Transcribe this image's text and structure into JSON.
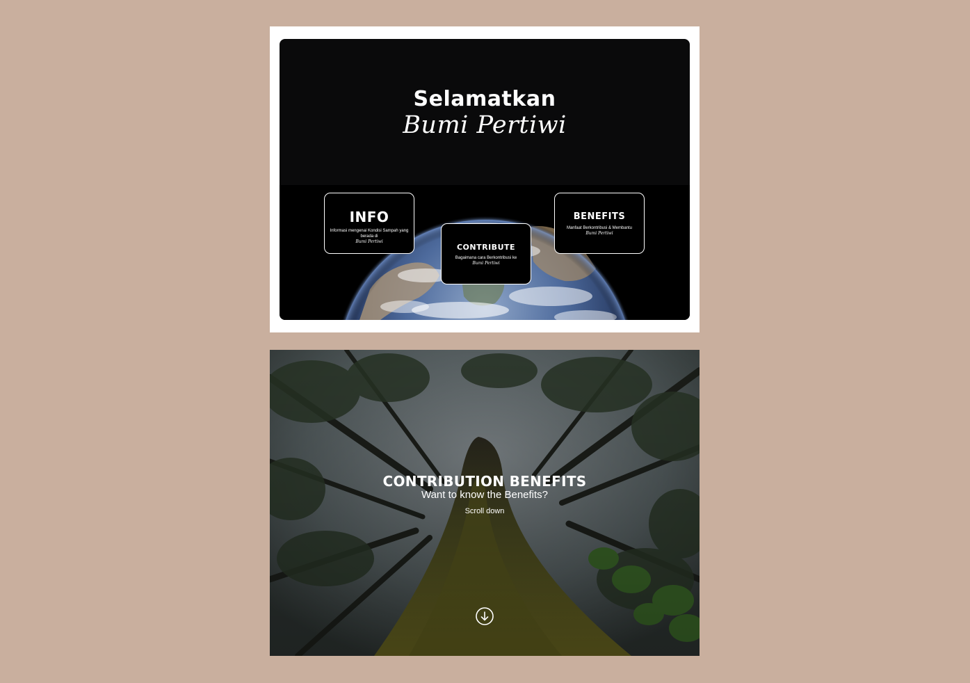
{
  "hero": {
    "title_line1": "Selamatkan",
    "title_line2": "Bumi Pertiwi"
  },
  "cards": {
    "info": {
      "title": "INFO",
      "desc": "Informasi mengenai Kondisi Sampah yang berada di",
      "desc_italic": "Bumi Pertiwi"
    },
    "contribute": {
      "title": "CONTRIBUTE",
      "desc": "Bagaimana cara Berkontribusi ke",
      "desc_italic": "Bumi Pertiwi"
    },
    "benefits": {
      "title": "BENEFITS",
      "desc": "Manfaat Berkontribusi & Membantu",
      "desc_italic": "Bumi Pertiwi"
    }
  },
  "benefits_section": {
    "title": "CONTRIBUTION BENEFITS",
    "subtitle": "Want to know the Benefits?",
    "scroll_label": "Scroll down"
  },
  "icons": {
    "earth": "earth-globe-image",
    "forest": "forest-canopy-image",
    "scroll": "arrow-down-circle-icon"
  },
  "colors": {
    "page_background": "#c9af9e",
    "slide_frame": "#ffffff",
    "dark_panel": "#0a0a0b",
    "text": "#ffffff"
  }
}
